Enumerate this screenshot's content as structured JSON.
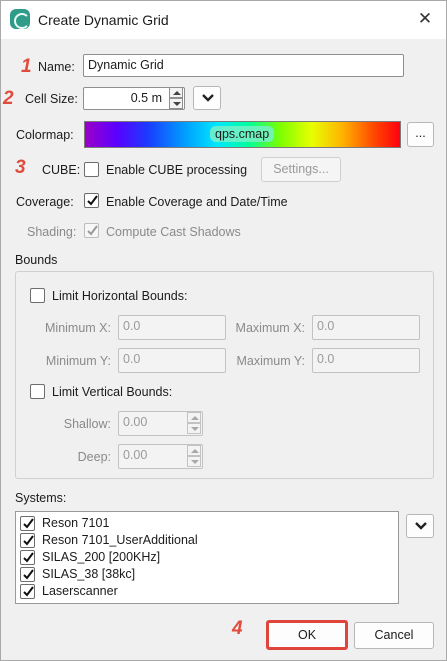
{
  "window": {
    "title": "Create Dynamic Grid"
  },
  "markers": [
    "1",
    "2",
    "3",
    "4"
  ],
  "name_field": {
    "label": "Name:",
    "value": "Dynamic Grid"
  },
  "cell_size": {
    "label": "Cell Size:",
    "value": "0.5 m"
  },
  "colormap": {
    "label": "Colormap:",
    "value": "qps.cmap",
    "browse_label": "..."
  },
  "cube": {
    "label": "CUBE:",
    "checkbox_label": "Enable CUBE processing",
    "checked": false,
    "settings_label": "Settings..."
  },
  "coverage": {
    "label": "Coverage:",
    "checkbox_label": "Enable Coverage and Date/Time",
    "checked": true
  },
  "shading": {
    "label": "Shading:",
    "checkbox_label": "Compute Cast Shadows",
    "checked": true,
    "enabled": false
  },
  "bounds": {
    "title": "Bounds",
    "horizontal": {
      "checkbox_label": "Limit Horizontal Bounds:",
      "min_x_label": "Minimum X:",
      "min_x": "0.0",
      "max_x_label": "Maximum X:",
      "max_x": "0.0",
      "min_y_label": "Minimum Y:",
      "min_y": "0.0",
      "max_y_label": "Maximum Y:",
      "max_y": "0.0"
    },
    "vertical": {
      "checkbox_label": "Limit Vertical Bounds:",
      "shallow_label": "Shallow:",
      "shallow": "0.00",
      "deep_label": "Deep:",
      "deep": "0.00"
    }
  },
  "systems": {
    "label": "Systems:",
    "items": [
      {
        "label": "Reson 7101",
        "checked": true
      },
      {
        "label": "Reson 7101_UserAdditional",
        "checked": true
      },
      {
        "label": "SILAS_200 [200KHz]",
        "checked": true
      },
      {
        "label": "SILAS_38 [38kc]",
        "checked": true
      },
      {
        "label": "Laserscanner",
        "checked": true
      }
    ]
  },
  "buttons": {
    "ok": "OK",
    "cancel": "Cancel"
  },
  "colors": {
    "marker": "#e14b3d",
    "ok_highlight": "#e0453c",
    "app_icon": "#2f9c8a"
  },
  "icons": {
    "app": "app-logo-icon",
    "close": "close-icon",
    "dropdown": "chevron-down-icon"
  }
}
